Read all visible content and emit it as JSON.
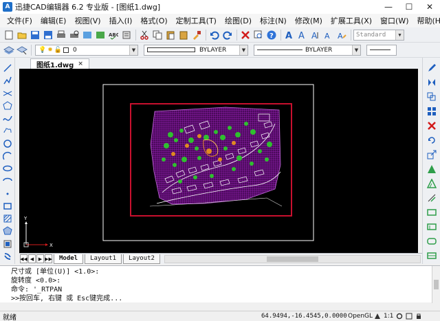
{
  "window": {
    "title": "迅捷CAD编辑器 6.2 专业版 - [图纸1.dwg]",
    "app_icon_letter": "A",
    "minimize": "—",
    "maximize": "☐",
    "close": "✕"
  },
  "menu": [
    "文件(F)",
    "编辑(E)",
    "视图(V)",
    "插入(I)",
    "格式(O)",
    "定制工具(T)",
    "绘图(D)",
    "标注(N)",
    "修改(M)",
    "扩展工具(X)",
    "窗口(W)",
    "帮助(H)"
  ],
  "toolbar": {
    "text_style": "Standard",
    "layer": "0",
    "color": "BYLAYER",
    "linetype": "BYLAYER"
  },
  "document_tab": {
    "label": "图纸1.dwg",
    "close": "×"
  },
  "layout_tabs": [
    "Model",
    "Layout1",
    "Layout2"
  ],
  "ucs": {
    "x_label": "X",
    "y_label": "Y"
  },
  "command_history": [
    "尺寸或 [单位(U)] <1.0>:",
    "旋转度 <0.0>:",
    "命令: '_RTPAN",
    ">>按回车, 右键 或 Esc键完成..."
  ],
  "status": {
    "left": "就绪",
    "coordinates": "64.9494,-16.4545,0.0000",
    "renderer": "OpenGL",
    "scale": "1:1"
  },
  "colors": {
    "canvas": "#000000",
    "border_red": "#c8102e",
    "hatch": "#8b1aa6",
    "vegetation": "#2fbf2f"
  }
}
